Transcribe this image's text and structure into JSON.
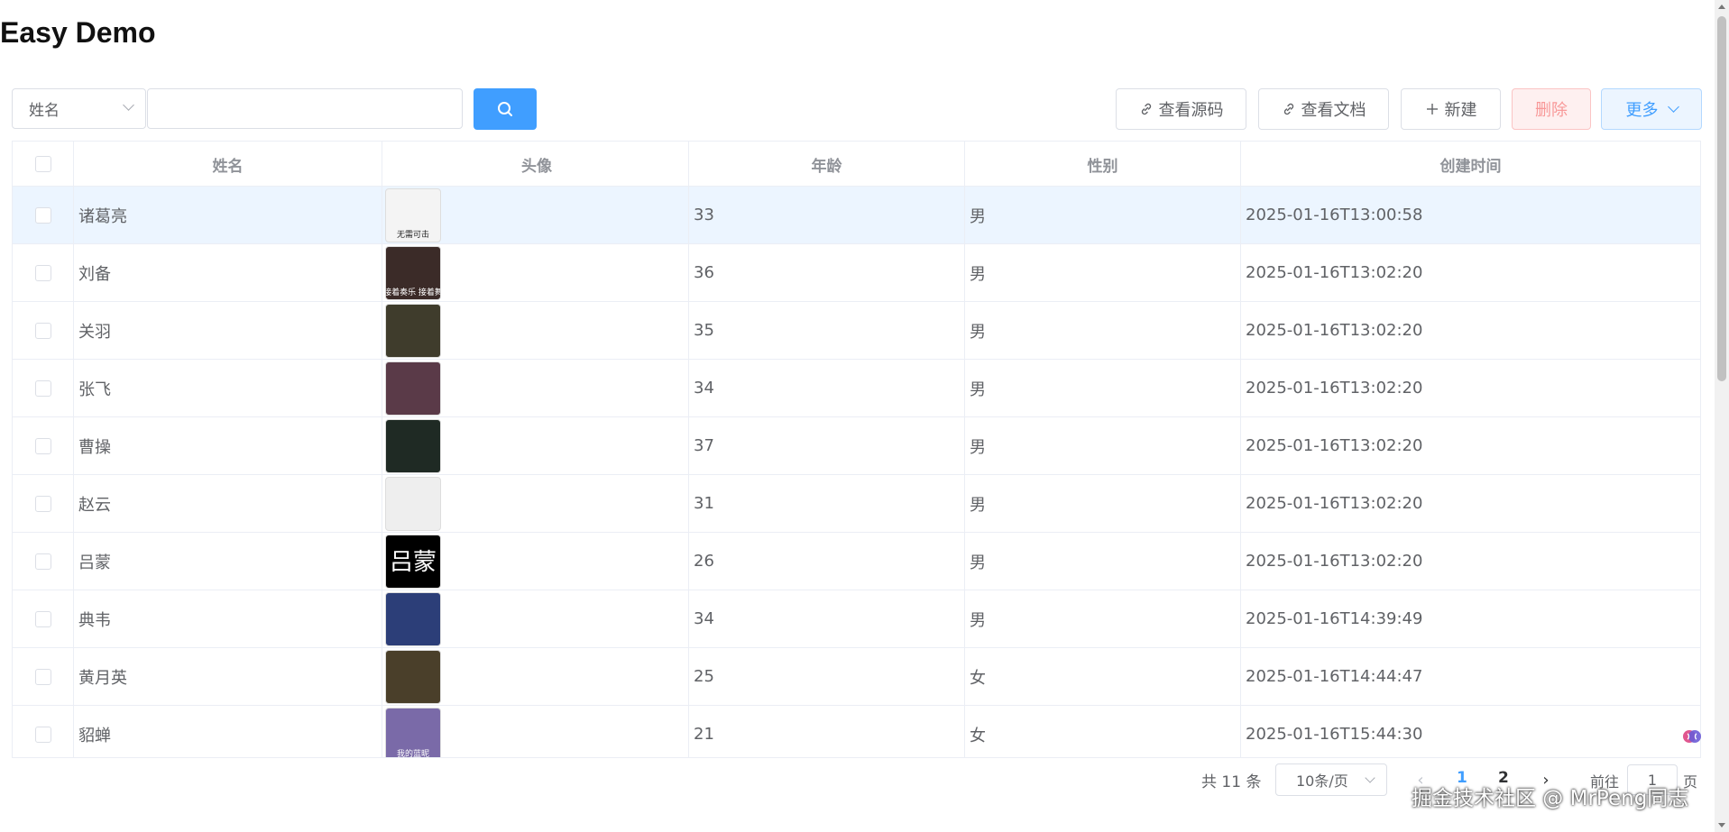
{
  "page": {
    "title": "Easy Demo"
  },
  "toolbar": {
    "field_select": "姓名",
    "search_value": "",
    "view_source_label": "查看源码",
    "view_docs_label": "查看文档",
    "new_label": "新建",
    "delete_label": "删除",
    "more_label": "更多"
  },
  "table": {
    "columns": [
      "姓名",
      "头像",
      "年龄",
      "性别",
      "创建时间"
    ],
    "rows": [
      {
        "name": "诸葛亮",
        "age": "33",
        "gender": "男",
        "created": "2025-01-16T13:00:58",
        "avatar_caption": "无需可击",
        "avatar_bg": "#f4f4f4",
        "avatar_fg": "#222222"
      },
      {
        "name": "刘备",
        "age": "36",
        "gender": "男",
        "created": "2025-01-16T13:02:20",
        "avatar_caption": "接着奏乐 接着舞",
        "avatar_bg": "#3b2b28",
        "avatar_fg": "#ffffff"
      },
      {
        "name": "关羽",
        "age": "35",
        "gender": "男",
        "created": "2025-01-16T13:02:20",
        "avatar_caption": "",
        "avatar_bg": "#3f3c2c",
        "avatar_fg": "#ffffff"
      },
      {
        "name": "张飞",
        "age": "34",
        "gender": "男",
        "created": "2025-01-16T13:02:20",
        "avatar_caption": "",
        "avatar_bg": "#5a3a48",
        "avatar_fg": "#ffffff"
      },
      {
        "name": "曹操",
        "age": "37",
        "gender": "男",
        "created": "2025-01-16T13:02:20",
        "avatar_caption": "",
        "avatar_bg": "#1f2a24",
        "avatar_fg": "#ffffff"
      },
      {
        "name": "赵云",
        "age": "31",
        "gender": "男",
        "created": "2025-01-16T13:02:20",
        "avatar_caption": "",
        "avatar_bg": "#eeeeee",
        "avatar_fg": "#333333"
      },
      {
        "name": "吕蒙",
        "age": "26",
        "gender": "男",
        "created": "2025-01-16T13:02:20",
        "avatar_caption": "吕蒙",
        "avatar_bg": "#000000",
        "avatar_fg": "#ffffff",
        "avatar_big": true
      },
      {
        "name": "典韦",
        "age": "34",
        "gender": "男",
        "created": "2025-01-16T14:39:49",
        "avatar_caption": "",
        "avatar_bg": "#2c3e78",
        "avatar_fg": "#ffffff"
      },
      {
        "name": "黄月英",
        "age": "25",
        "gender": "女",
        "created": "2025-01-16T14:44:47",
        "avatar_caption": "",
        "avatar_bg": "#4a3f2a",
        "avatar_fg": "#ffffff"
      },
      {
        "name": "貂蝉",
        "age": "21",
        "gender": "女",
        "created": "2025-01-16T15:44:30",
        "avatar_caption": "我的蓝昵",
        "avatar_bg": "#7a6aa8",
        "avatar_fg": "#ffffff"
      }
    ]
  },
  "pagination": {
    "total": "共 11 条",
    "page_size": "10条/页",
    "pages": [
      "1",
      "2"
    ],
    "current": "1",
    "goto_label": "前往",
    "goto_value": "1",
    "page_unit": "页"
  },
  "watermark": "掘金技术社区 @ MrPeng同志",
  "colors": {
    "primary": "#409eff",
    "danger_light": "#fef0f0",
    "row_highlight": "#ecf5ff"
  }
}
